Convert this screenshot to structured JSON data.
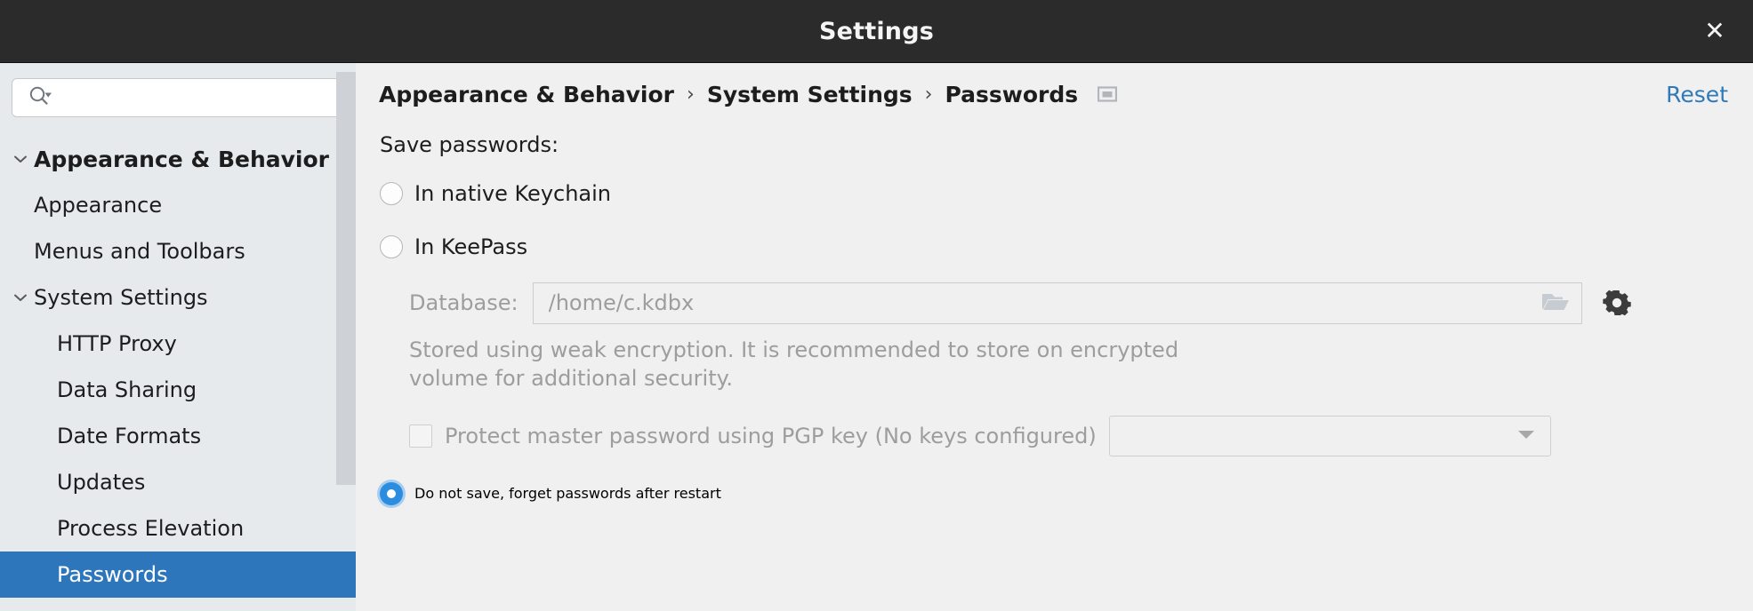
{
  "window": {
    "title": "Settings",
    "close_icon": "close-icon",
    "close_glyph": "✕"
  },
  "sidebar": {
    "search": {
      "icon": "search-icon",
      "value": "",
      "placeholder": ""
    },
    "tree": [
      {
        "label": "Appearance & Behavior",
        "level": 0,
        "expanded": true,
        "selected": false
      },
      {
        "label": "Appearance",
        "level": 1,
        "expanded": null,
        "selected": false
      },
      {
        "label": "Menus and Toolbars",
        "level": 1,
        "expanded": null,
        "selected": false
      },
      {
        "label": "System Settings",
        "level": 1,
        "expanded": true,
        "selected": false
      },
      {
        "label": "HTTP Proxy",
        "level": 2,
        "expanded": null,
        "selected": false
      },
      {
        "label": "Data Sharing",
        "level": 2,
        "expanded": null,
        "selected": false
      },
      {
        "label": "Date Formats",
        "level": 2,
        "expanded": null,
        "selected": false
      },
      {
        "label": "Updates",
        "level": 2,
        "expanded": null,
        "selected": false
      },
      {
        "label": "Process Elevation",
        "level": 2,
        "expanded": null,
        "selected": false
      },
      {
        "label": "Passwords",
        "level": 2,
        "expanded": null,
        "selected": true
      }
    ]
  },
  "breadcrumb": {
    "items": [
      "Appearance & Behavior",
      "System Settings",
      "Passwords"
    ],
    "separator": "›",
    "badge_icon": "window-badge-icon",
    "reset_label": "Reset"
  },
  "main": {
    "section_label": "Save passwords:",
    "options": [
      {
        "label": "In native Keychain",
        "selected": false
      },
      {
        "label": "In KeePass",
        "selected": false
      },
      {
        "label": "Do not save, forget passwords after restart",
        "selected": true
      }
    ],
    "database": {
      "label": "Database:",
      "value": "/home/c.kdbx",
      "browse_icon": "folder-icon",
      "settings_icon": "gear-icon"
    },
    "hint_line1": "Stored using weak encryption. It is recommended to store on encrypted",
    "hint_line2": "volume for additional security.",
    "pgp": {
      "label": "Protect master password using PGP key (No keys configured)",
      "checked": false,
      "select_value": "",
      "dropdown_icon": "chevron-down-icon"
    }
  },
  "colors": {
    "titlebar_bg": "#2b2b2b",
    "sidebar_bg": "#e6eaed",
    "main_bg": "#f0f0f0",
    "selection_blue": "#2d76bb",
    "link_blue": "#3079b8",
    "radio_blue": "#2b8ce0",
    "disabled_text": "#9d9d9d"
  }
}
